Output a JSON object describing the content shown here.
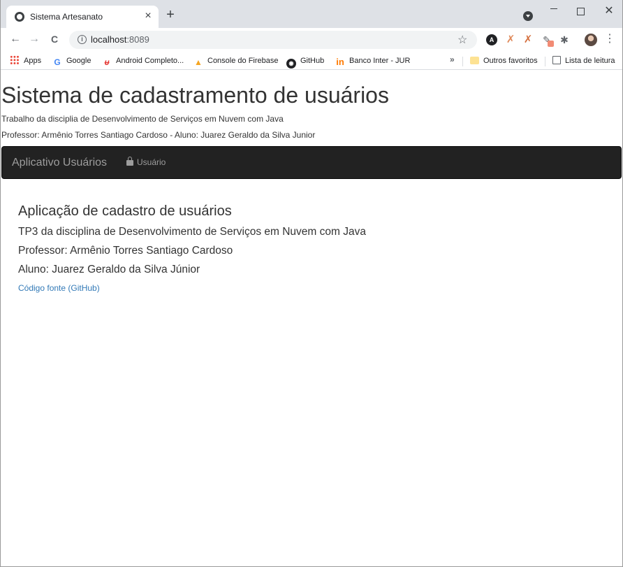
{
  "browser": {
    "tab_title": "Sistema Artesanato",
    "tab_close": "×",
    "new_tab": "+",
    "url_host": "localhost",
    "url_port": ":8089",
    "nav": {
      "back": "←",
      "forward": "→",
      "reload": "C"
    },
    "window": {
      "minimize": "",
      "maximize": "",
      "close": "✕"
    },
    "menu": "⋮",
    "extensions": [
      "A",
      "✗",
      "✗",
      "✎",
      "✱"
    ]
  },
  "bookmarks": {
    "items": [
      {
        "label": "Apps",
        "icon": "apps-grid-icon"
      },
      {
        "label": "Google",
        "icon": "google-icon"
      },
      {
        "label": "Android Completo...",
        "icon": "android-completo-icon"
      },
      {
        "label": "Console do Firebase",
        "icon": "firebase-icon"
      },
      {
        "label": "GitHub",
        "icon": "github-icon"
      },
      {
        "label": "Banco Inter - JUR",
        "icon": "inter-icon"
      }
    ],
    "more": "»",
    "other_favorites": "Outros favoritos",
    "reading_list": "Lista de leitura"
  },
  "page": {
    "title": "Sistema de cadastramento de usuários",
    "subtitle1": "Trabalho da disciplia de Desenvolvimento de Serviços em Nuvem com Java",
    "subtitle2": "Professor: Armênio Torres Santiago Cardoso - Aluno: Juarez Geraldo da Silva Junior",
    "navbar": {
      "brand": "Aplicativo Usuários",
      "link_user": "Usuário"
    },
    "main": {
      "heading": "Aplicação de cadastro de usuários",
      "line1": "TP3 da disciplina de Desenvolvimento de Serviços em Nuvem com Java",
      "line2": "Professor: Armênio Torres Santiago Cardoso",
      "line3": "Aluno: Juarez Geraldo da Silva Júnior",
      "source_link": "Código fonte (GitHub)"
    }
  },
  "colors": {
    "navbar_bg": "#222222",
    "navbar_text": "#9d9d9d",
    "link": "#337ab7",
    "text": "#333333"
  }
}
